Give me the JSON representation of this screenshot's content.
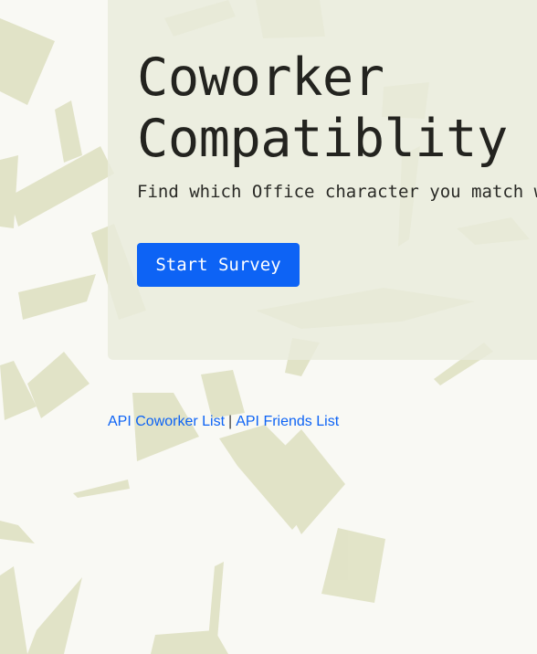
{
  "hero": {
    "title_line1": "Coworker",
    "title_line2": "Compatiblity",
    "subtitle": "Find which Office character you match with",
    "start_button_label": "Start Survey"
  },
  "links": {
    "coworker_list": "API Coworker List",
    "separator": "|",
    "friends_list": "API Friends List"
  },
  "colors": {
    "background": "#f9f9f4",
    "hero_panel": "#e9ebdc",
    "paper": "#d9dbb8",
    "accent": "#0d63f5"
  },
  "decoration": {
    "background_image": "falling-paper-sheets"
  }
}
